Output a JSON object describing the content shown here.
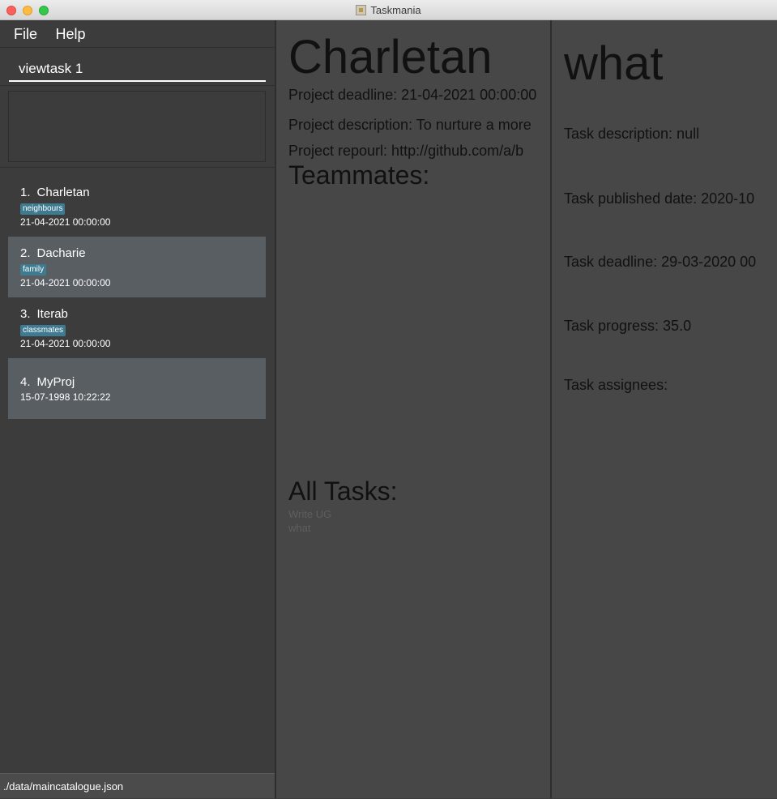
{
  "window": {
    "title": "Taskmania"
  },
  "menu": {
    "file": "File",
    "help": "Help"
  },
  "command": {
    "value": "viewtask 1"
  },
  "projects": [
    {
      "index": "1.",
      "name": "Charletan",
      "tag": "neighbours",
      "date": "21-04-2021 00:00:00"
    },
    {
      "index": "2.",
      "name": "Dacharie",
      "tag": "family",
      "date": "21-04-2021 00:00:00"
    },
    {
      "index": "3.",
      "name": "Iterab",
      "tag": "classmates",
      "date": "21-04-2021 00:00:00"
    },
    {
      "index": "4.",
      "name": "MyProj",
      "date": "15-07-1998 10:22:22"
    }
  ],
  "status": {
    "path": "./data/maincatalogue.json"
  },
  "project_detail": {
    "name": "Charletan",
    "deadline": "Project deadline: 21-04-2021 00:00:00",
    "description": "Project description: To nurture a more",
    "repourl": "Project repourl: http://github.com/a/b",
    "teammates_heading": "Teammates:",
    "tasks_heading": "All Tasks:",
    "tasks": [
      "Write UG",
      "what"
    ]
  },
  "task_detail": {
    "name": "what",
    "description": "Task description: null",
    "published": "Task published date: 2020-10",
    "deadline": "Task deadline: 29-03-2020 00",
    "progress": "Task progress: 35.0",
    "assignees": "Task assignees:"
  }
}
